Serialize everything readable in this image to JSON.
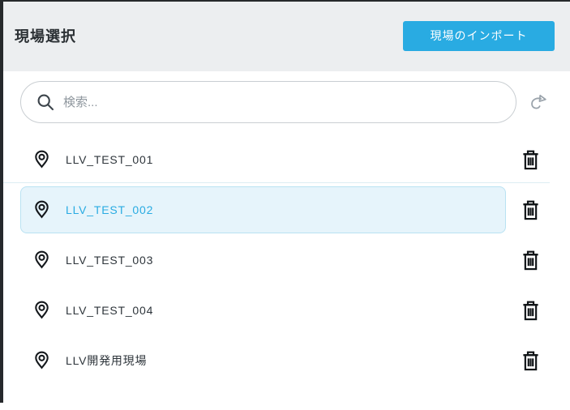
{
  "header": {
    "title": "現場選択",
    "import_button_label": "現場のインポート"
  },
  "search": {
    "placeholder": "検索...",
    "icons": [
      "search-icon",
      "redo-icon"
    ]
  },
  "sites": [
    {
      "label": "LLV_TEST_001",
      "selected": false
    },
    {
      "label": "LLV_TEST_002",
      "selected": true
    },
    {
      "label": "LLV_TEST_003",
      "selected": false
    },
    {
      "label": "LLV_TEST_004",
      "selected": false
    },
    {
      "label": "LLV開発用現場",
      "selected": false
    }
  ],
  "row_icons": {
    "left": "location-pin-icon",
    "right": "trash-icon"
  },
  "colors": {
    "accent": "#29abe2",
    "header_bg": "#eceef0",
    "selected_bg": "#e6f4fb",
    "selected_border": "#b9e2f2",
    "text_dark": "#2e353b",
    "placeholder": "#8f979e",
    "edge_dark": "#26292c"
  }
}
